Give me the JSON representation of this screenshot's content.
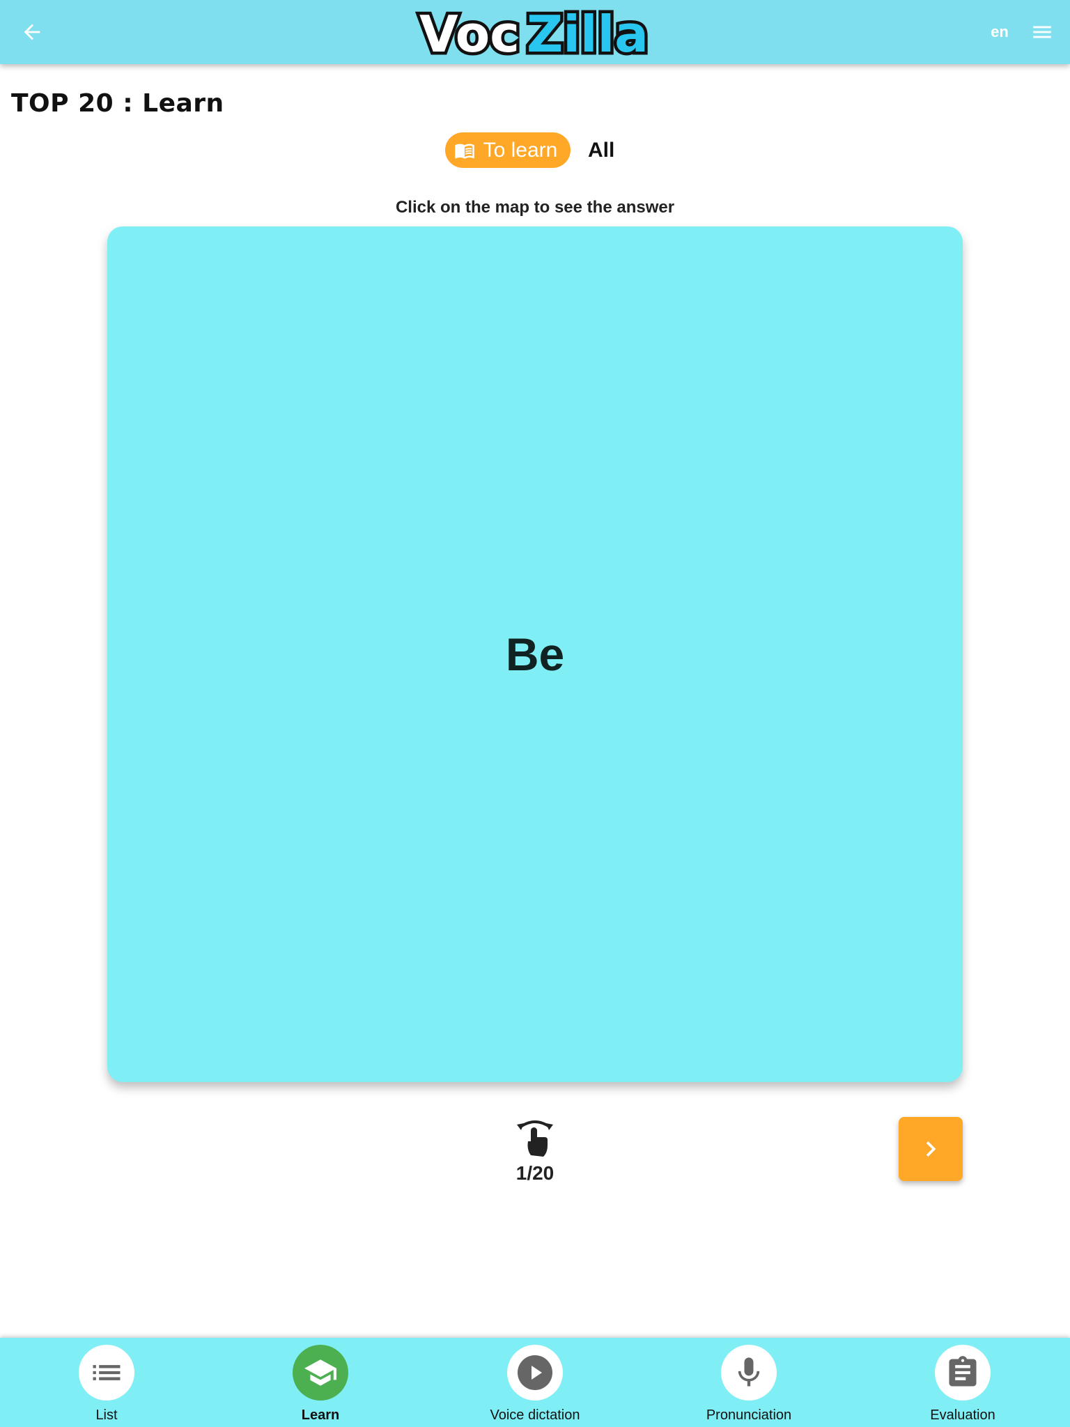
{
  "header": {
    "logo_text_1": "Voc",
    "logo_text_2": "Zilla",
    "language": "en",
    "back_icon": "arrow-left-icon",
    "menu_icon": "hamburger-menu-icon"
  },
  "page": {
    "title": "TOP 20 : Learn"
  },
  "filters": {
    "to_learn": "To learn",
    "all": "All",
    "active": "to_learn"
  },
  "hint": "Click on the map to see the answer",
  "card": {
    "word": "Be"
  },
  "progress": {
    "text": "1/20",
    "current": 1,
    "total": 20
  },
  "bottom_nav": {
    "items": [
      {
        "label": "List",
        "icon": "list-icon",
        "active": false
      },
      {
        "label": "Learn",
        "icon": "graduation-cap-icon",
        "active": true
      },
      {
        "label": "Voice dictation",
        "icon": "play-icon",
        "active": false
      },
      {
        "label": "Pronunciation",
        "icon": "microphone-icon",
        "active": false
      },
      {
        "label": "Evaluation",
        "icon": "clipboard-icon",
        "active": false
      }
    ]
  },
  "colors": {
    "header_bg": "#7fdfee",
    "card_bg": "#80eff5",
    "accent_orange": "#ffa726",
    "active_green": "#4caf50",
    "logo_blue": "#29c6f0"
  }
}
